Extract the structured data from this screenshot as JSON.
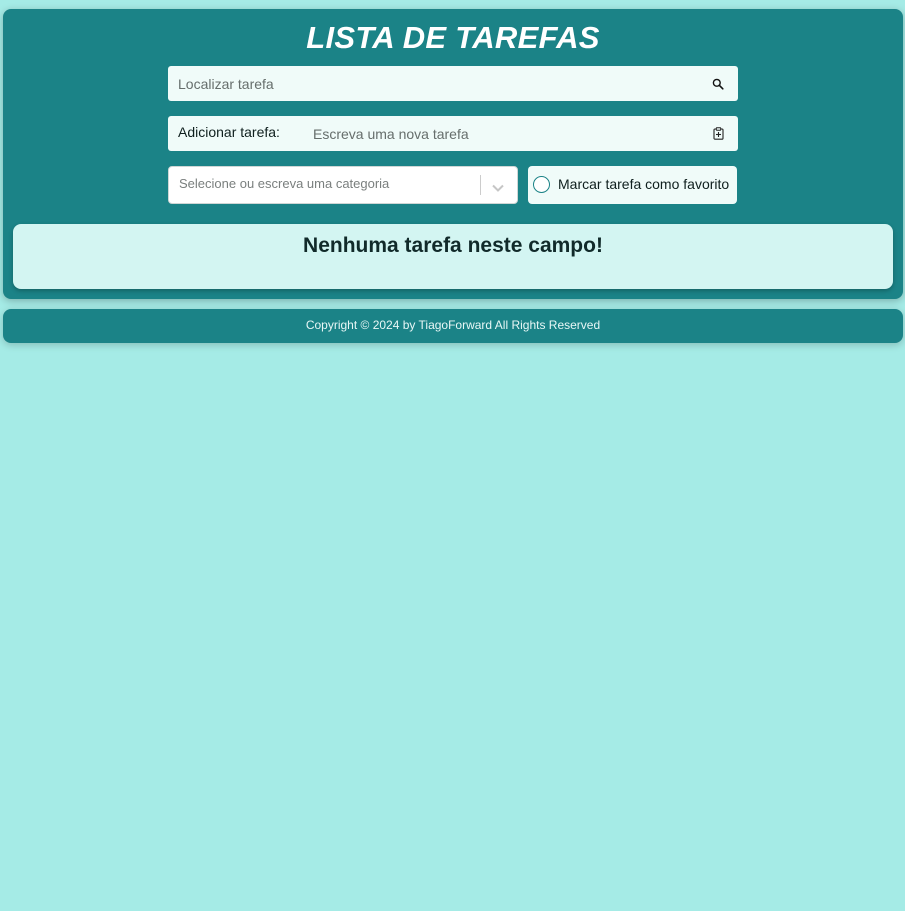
{
  "header": {
    "title": "LISTA DE TAREFAS"
  },
  "search": {
    "placeholder": "Localizar tarefa",
    "icon": "search-icon"
  },
  "add_task": {
    "label": "Adicionar tarefa:",
    "placeholder": "Escreva uma nova tarefa",
    "icon": "clipboard-icon"
  },
  "category": {
    "placeholder": "Selecione ou escreva uma categoria",
    "icon": "chevron-down-icon"
  },
  "favorite": {
    "label": "Marcar tarefa como favorito",
    "checked": false
  },
  "tasks": {
    "empty_message": "Nenhuma tarefa neste campo!"
  },
  "footer": {
    "copyright": "Copyright © 2024 by TiagoForward All Rights Reserved"
  },
  "colors": {
    "page_background": "#a5ebe6",
    "panel": "#1b8387",
    "input_background": "#f0fbf9",
    "task_area": "#d3f5f2"
  }
}
